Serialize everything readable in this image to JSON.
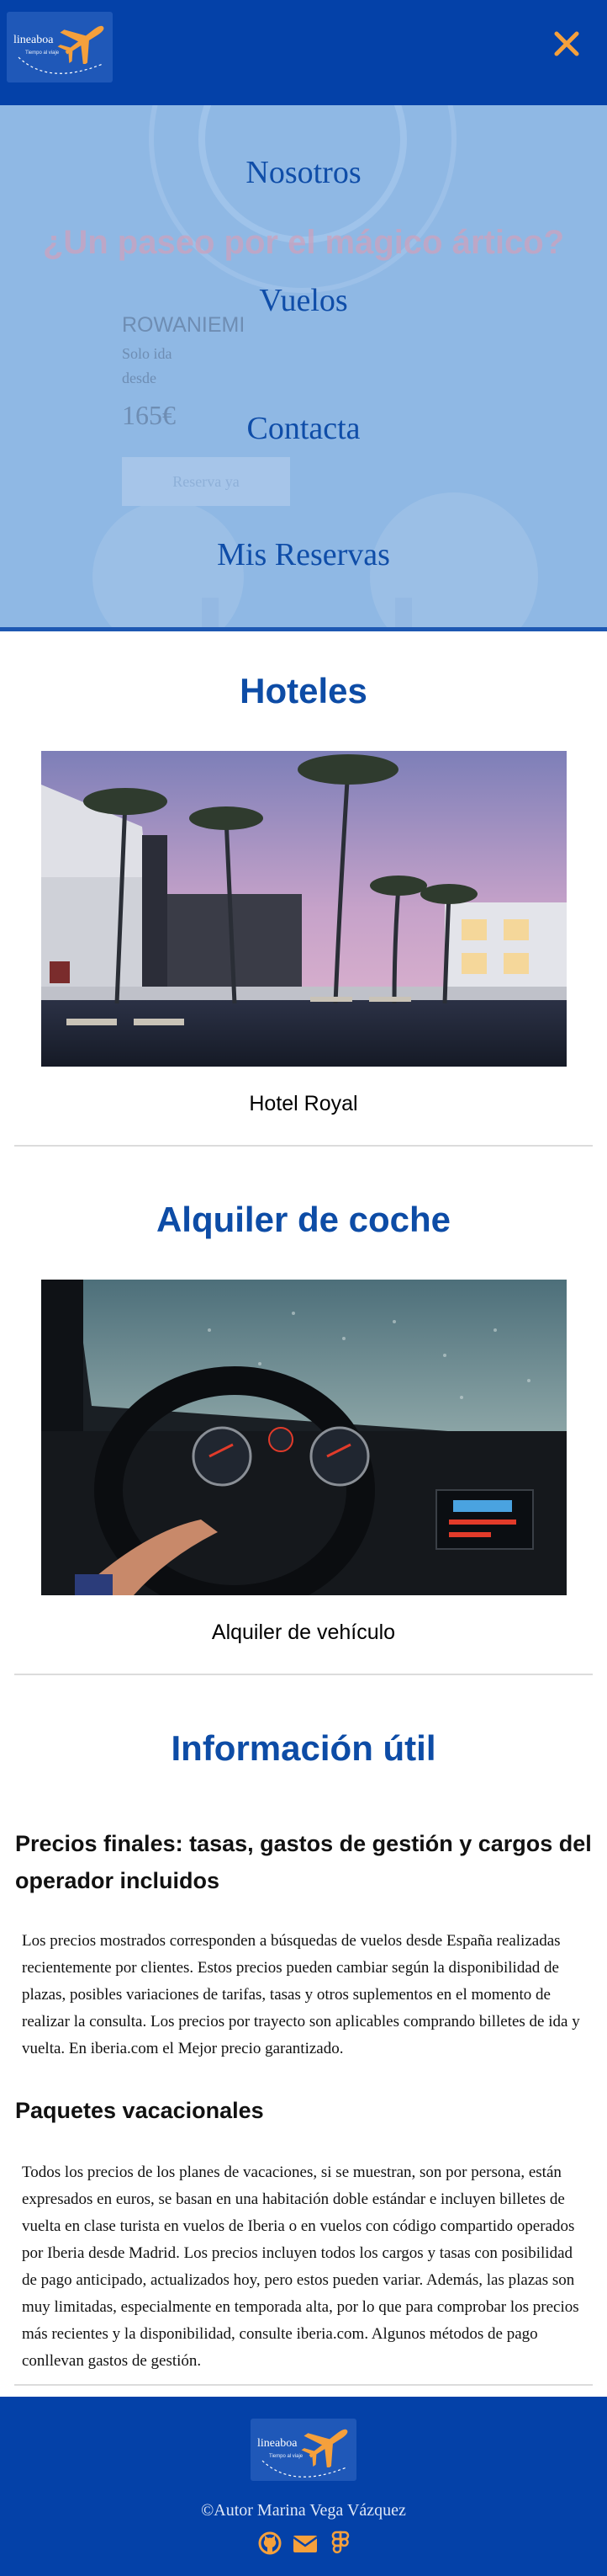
{
  "header": {
    "logo_text": "lineaboa",
    "logo_tagline": "Tiempo al viaje",
    "close_label": "✕"
  },
  "hero": {
    "promo_title": "¿Un paseo por el mágico ártico?",
    "city": "ROWANIEMI",
    "trip_type": "Solo ida",
    "from_label": "desde",
    "price": "165€",
    "reserve_button": "Reserva ya"
  },
  "menu": {
    "items": [
      {
        "label": "Nosotros"
      },
      {
        "label": "Vuelos"
      },
      {
        "label": "Contacta"
      },
      {
        "label": "Mis Reservas"
      }
    ]
  },
  "hotels": {
    "title": "Hoteles",
    "caption": "Hotel Royal"
  },
  "car_rental": {
    "title": "Alquiler de coche",
    "caption": "Alquiler de vehículo"
  },
  "useful_info": {
    "title": "Información útil",
    "sections": [
      {
        "heading": "Precios finales: tasas, gastos de gestión y cargos del operador incluidos",
        "body": "Los precios mostrados corresponden a búsquedas de vuelos desde España realizadas recientemente por clientes. Estos precios pueden cambiar según la disponibilidad de plazas, posibles variaciones de tarifas, tasas y otros suplementos en el momento de realizar la consulta. Los precios por trayecto son aplicables comprando billetes de ida y vuelta. En iberia.com el Mejor precio garantizado."
      },
      {
        "heading": "Paquetes vacacionales",
        "body": "Todos los precios de los planes de vacaciones, si se muestran, son por persona, están expresados en euros, se basan en una habitación doble estándar e incluyen billetes de vuelta en clase turista en vuelos de Iberia o en vuelos con código compartido operados por Iberia desde Madrid. Los precios incluyen todos los cargos y tasas con posibilidad de pago anticipado, actualizados hoy, pero estos pueden variar. Además, las plazas son muy limitadas, especialmente en temporada alta, por lo que para comprobar los precios más recientes y la disponibilidad, consulte iberia.com. Algunos métodos de pago conllevan gastos de gestión."
      }
    ]
  },
  "footer": {
    "logo_text": "lineaboa",
    "logo_tagline": "Tiempo al viaje",
    "author": "©Autor Marina Vega Vázquez",
    "icons": [
      "github-icon",
      "email-icon",
      "figma-icon"
    ]
  },
  "colors": {
    "brand_blue": "#0441a8",
    "accent_orange": "#f5a03c",
    "menu_overlay": "#8fb8e4",
    "heading_blue": "#0d4ca6"
  }
}
